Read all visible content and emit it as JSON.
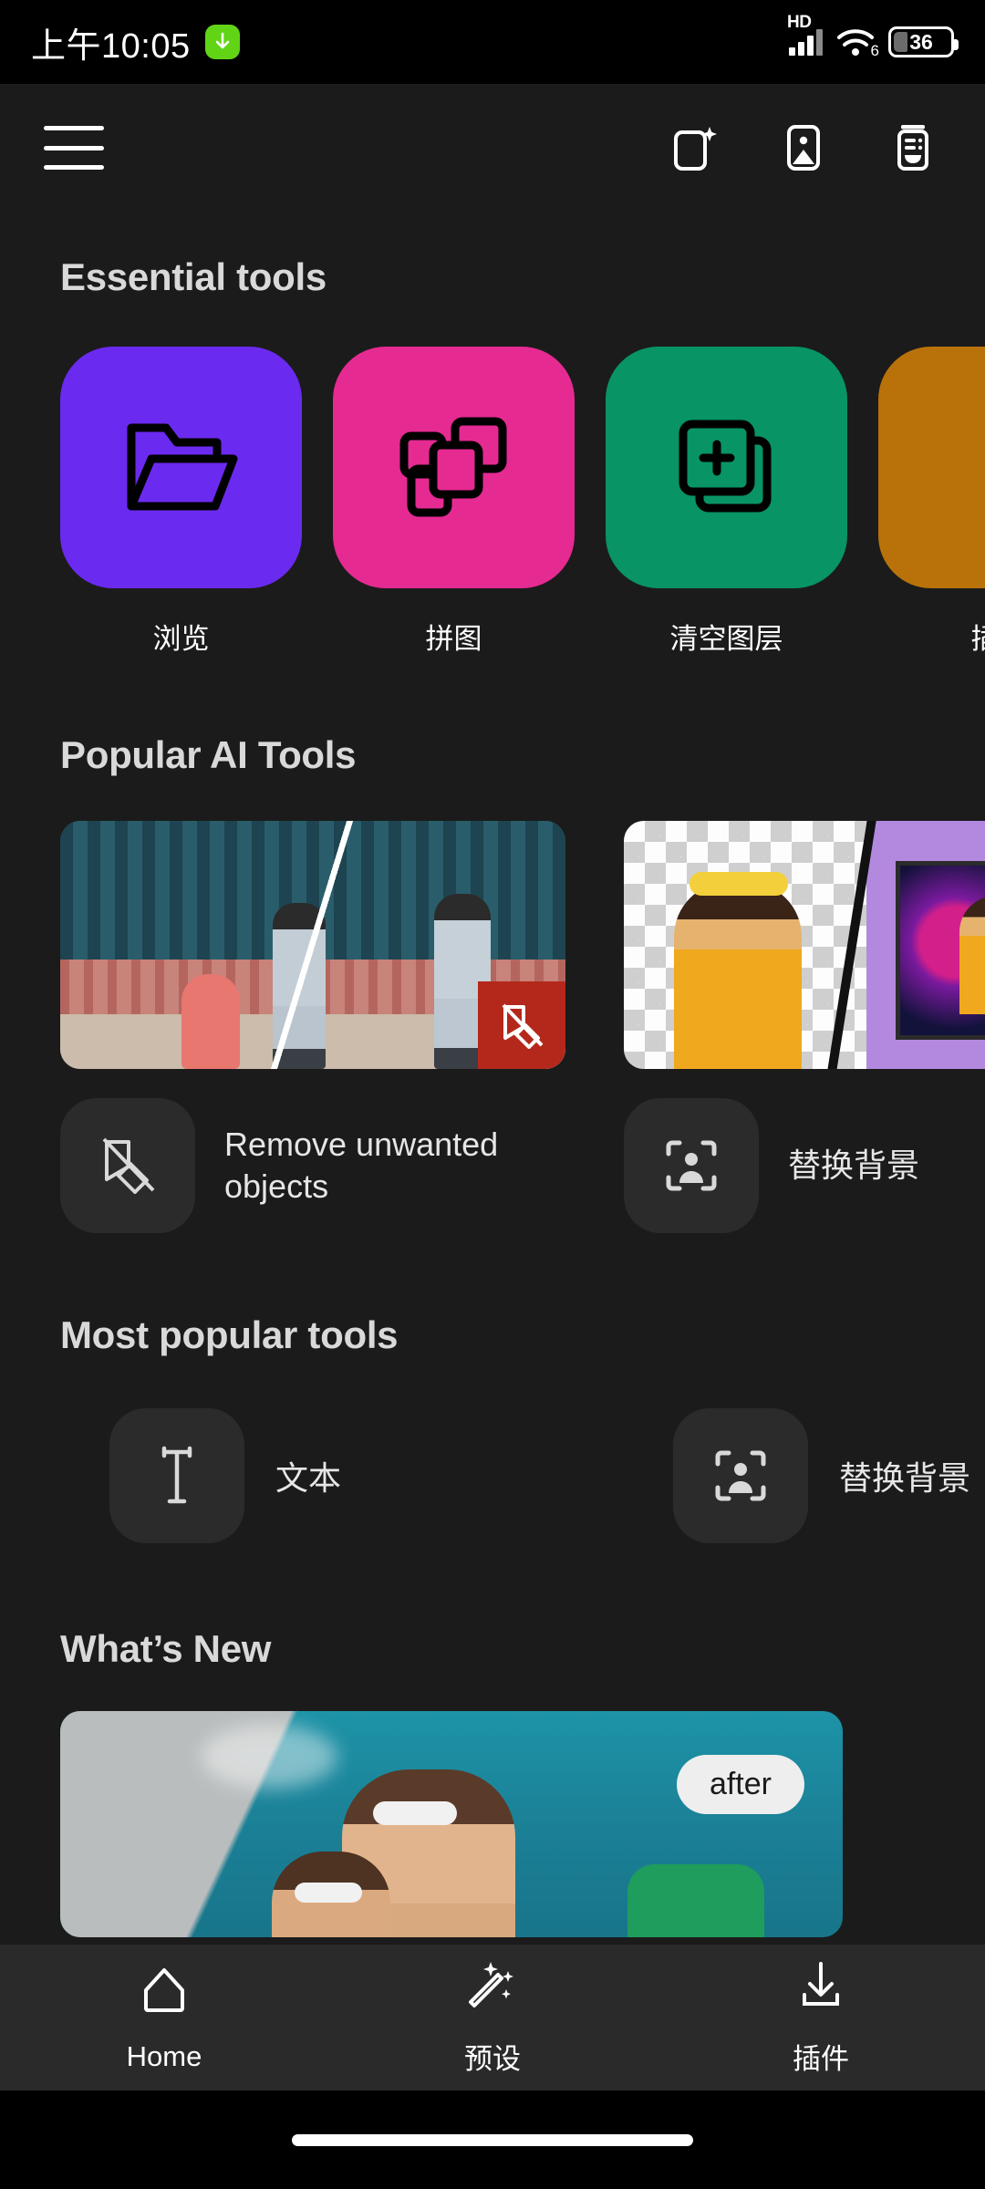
{
  "statusbar": {
    "time": "上午10:05",
    "download_icon": "download-badge-icon",
    "network_label": "HD",
    "signal_icon": "signal-bars-icon",
    "wifi_icon": "wifi-icon",
    "wifi_generation": "6",
    "battery_percent": "36",
    "battery_icon": "battery-icon"
  },
  "appbar": {
    "menu_icon": "hamburger-menu-icon",
    "actions": [
      {
        "name": "new-project-icon",
        "label": "New project"
      },
      {
        "name": "image-library-icon",
        "label": "Image library"
      },
      {
        "name": "archive-icon",
        "label": "Archive"
      }
    ]
  },
  "sections": {
    "essential": {
      "title": "Essential tools",
      "tools": [
        {
          "label": "浏览",
          "icon": "folder-icon",
          "color": "#6b2af0"
        },
        {
          "label": "拼图",
          "icon": "collage-icon",
          "color": "#e52a92"
        },
        {
          "label": "清空图层",
          "icon": "add-layer-icon",
          "color": "#089465"
        },
        {
          "label": "插件",
          "icon": "plugin-icon",
          "color": "#b9720a"
        }
      ]
    },
    "popular_ai": {
      "title": "Popular AI Tools",
      "cards": [
        {
          "label": "Remove unwanted objects",
          "icon": "object-remove-icon",
          "thumb": "before-after-remove-object"
        },
        {
          "label": "替换背景",
          "icon": "replace-background-icon",
          "thumb": "before-after-replace-background"
        }
      ]
    },
    "most_popular": {
      "title": "Most popular tools",
      "items": [
        {
          "label": "文本",
          "icon": "text-tool-icon"
        },
        {
          "label": "替换背景",
          "icon": "replace-background-icon"
        }
      ]
    },
    "whats_new": {
      "title": "What’s New",
      "card": {
        "badge": "after",
        "thumb": "before-after-sky-photo"
      }
    }
  },
  "bottomnav": {
    "items": [
      {
        "label": "Home",
        "icon": "home-icon",
        "active": true
      },
      {
        "label": "预设",
        "icon": "magic-wand-icon",
        "active": false
      },
      {
        "label": "插件",
        "icon": "download-icon",
        "active": false
      }
    ]
  },
  "colors": {
    "background": "#1b1b1b",
    "statusbar": "#000000",
    "navbar": "#2a2a2a",
    "tile_purple": "#6b2af0",
    "tile_pink": "#e52a92",
    "tile_green": "#089465",
    "tile_orange": "#b9720a",
    "badge_red": "#b4281c",
    "download_green": "#62d416"
  }
}
